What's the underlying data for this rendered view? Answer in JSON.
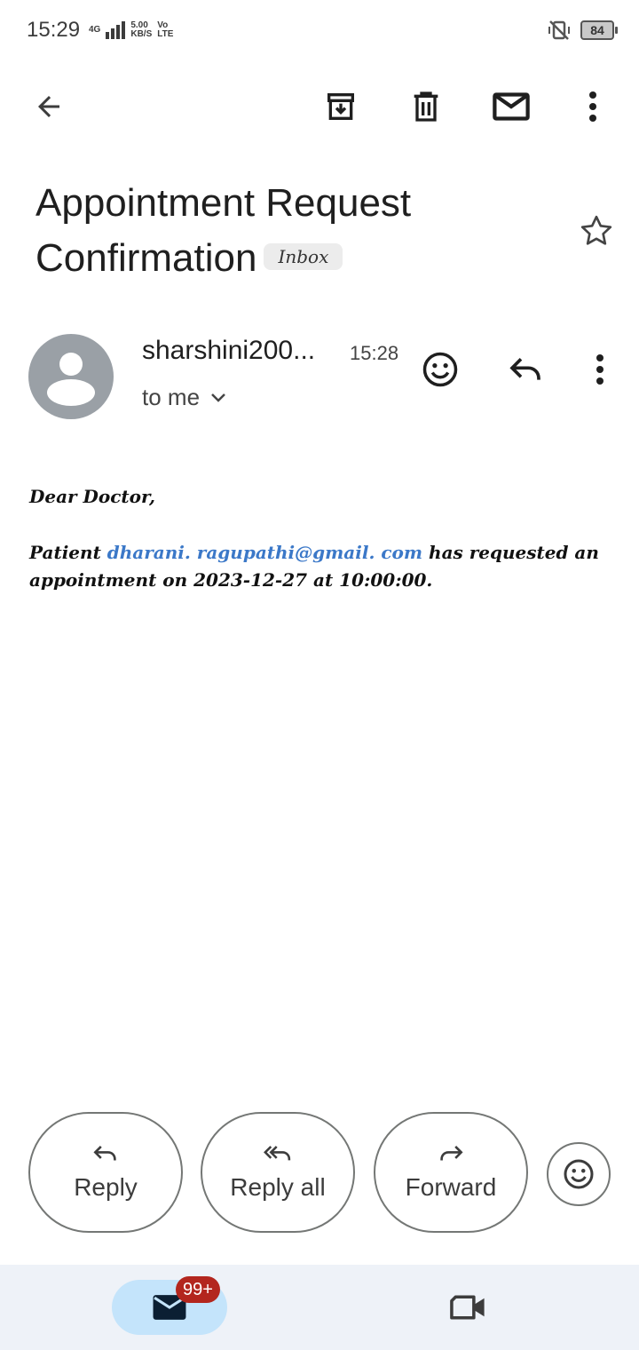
{
  "status_bar": {
    "time": "15:29",
    "network_type": "4G",
    "speed_value": "5.00",
    "speed_unit": "KB/S",
    "volte_top": "Vo",
    "volte_bottom": "LTE",
    "battery": "84"
  },
  "toolbar": {
    "back_icon": "back-arrow-icon",
    "archive_icon": "archive-icon",
    "delete_icon": "trash-icon",
    "mark_unread_icon": "mail-icon",
    "more_icon": "more-vert-icon"
  },
  "email": {
    "subject": "Appointment Request Confirmation",
    "label": "Inbox",
    "sender": "sharshini200...",
    "time": "15:28",
    "recipient": "to me",
    "greeting": "Dear Doctor,",
    "body_prefix": "Patient ",
    "body_email": "dharani. ragupathi@gmail. com",
    "body_suffix": " has requested an appointment on 2023-12-27 at 10:00:00."
  },
  "actions": {
    "reply": "Reply",
    "reply_all": "Reply all",
    "forward": "Forward"
  },
  "bottom_nav": {
    "mail_badge": "99+"
  },
  "colors": {
    "accent_link": "#3b78c8",
    "nav_background": "#eef2f8",
    "mail_pill": "#c4e4fb",
    "badge": "#b3261e",
    "avatar": "#9aa0a6"
  }
}
